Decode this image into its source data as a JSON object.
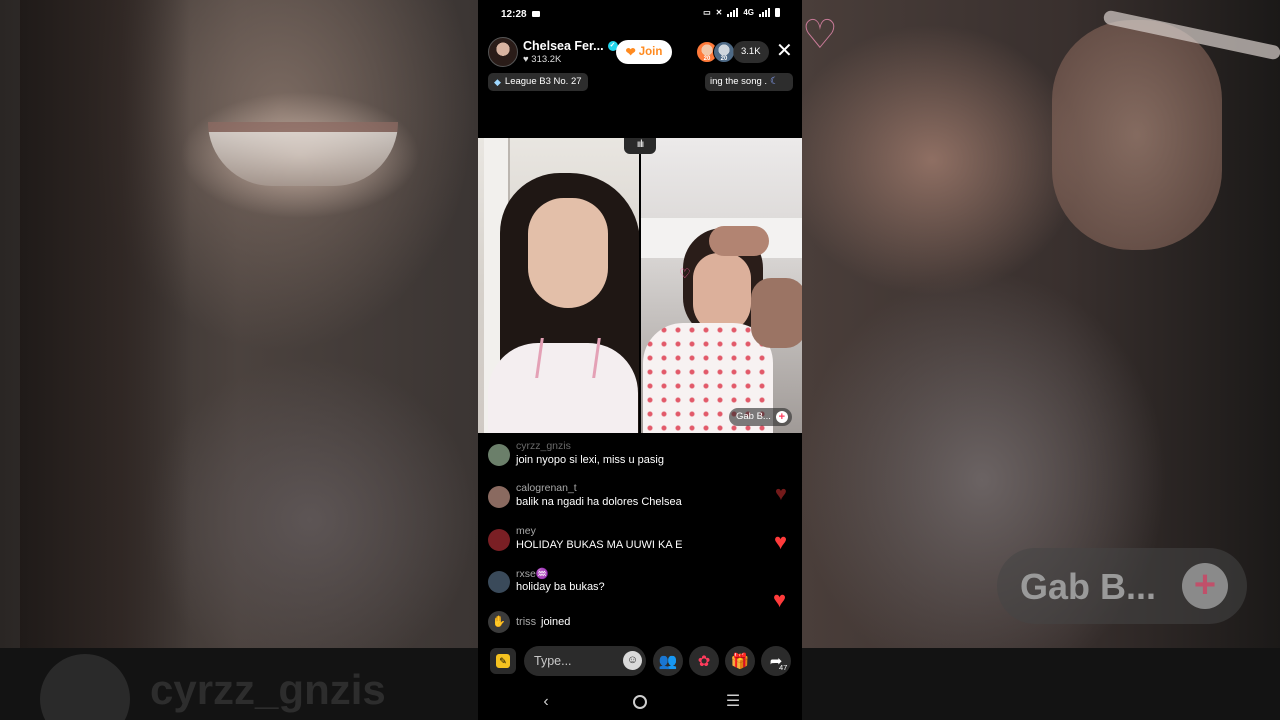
{
  "status_bar": {
    "time": "12:28",
    "network": "4G"
  },
  "live": {
    "host_name": "Chelsea Fer...",
    "host_likes": "313.2K",
    "join_label": "Join",
    "viewer_count": "3.1K",
    "viewer_badge_1": "20",
    "viewer_badge_2": "20",
    "league_label": "League B3 No. 27",
    "song_text": "ing the song ."
  },
  "guest": {
    "name": "Gab B..."
  },
  "chat": {
    "messages": [
      {
        "user": "cyrzz_gnzis",
        "text": "join nyopo si lexi, miss u pasig",
        "avatar_color": "#6b7f6a"
      },
      {
        "user": "calogrenan_t",
        "text": "balik na ngadi ha dolores Chelsea",
        "avatar_color": "#8a6a60"
      },
      {
        "user": "mey",
        "text": "HOLIDAY BUKAS MA UUWI KA E",
        "avatar_color": "#7a1f24"
      },
      {
        "user": "rxse",
        "text": "holiday ba bukas?",
        "avatar_color": "#3a4a5a"
      }
    ],
    "join_event": {
      "user": "triss",
      "text": "joined"
    }
  },
  "bottom_bar": {
    "comment_placeholder": "Type...",
    "share_count": "47"
  },
  "background": {
    "ghost_username": "cyrzz_gnzis",
    "ghost_guest": "Gab B..."
  },
  "colors": {
    "heart": "#ff3b3b",
    "join_orange": "#ff8a1f",
    "verified": "#20d5ec",
    "quick_yellow": "#f5c220"
  },
  "icons": {
    "verified": "verified-badge-icon",
    "close": "close-icon",
    "league": "diamond-icon",
    "audio": "audio-wave-icon",
    "emoji": "emoji-icon",
    "co_host": "co-host-icon",
    "rose": "rose-gift-icon",
    "gift": "gift-icon",
    "share": "share-icon"
  }
}
